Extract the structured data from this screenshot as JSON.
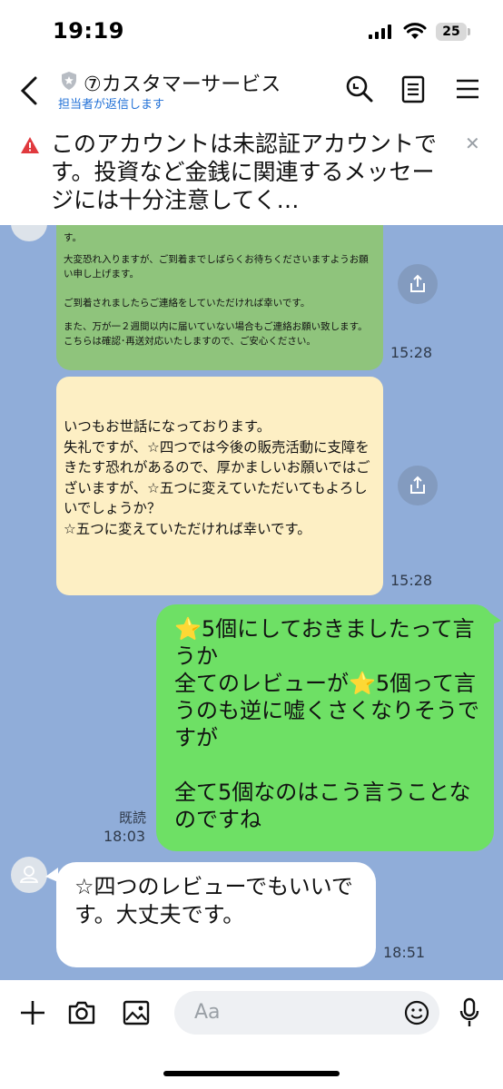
{
  "status_bar": {
    "time": "19:19",
    "battery": "25"
  },
  "header": {
    "account_name": "⑦カスタマーサービス",
    "subtitle": "担当者が返信します"
  },
  "warning": {
    "text": "このアカウントは未認証アカウントです。投資など金銭に関連するメッセージには十分注意してく…",
    "close_glyph": "✕"
  },
  "messages": [
    {
      "from": "other",
      "style": "green-image",
      "lines": [
        "す。",
        "大変恐れ入りますが、ご到着までしばらくお待ちくださいますようお願い申し上げます。",
        "ご到着されましたらご連絡をしていただければ幸いです。",
        "また、万が一２週間以内に届いていない場合もご連絡お願い致します。こちらは確認･再送対応いたしますので、ご安心ください。"
      ],
      "time": "15:28"
    },
    {
      "from": "other",
      "style": "yellow-image",
      "text": "いつもお世話になっております。\n失礼ですが、☆四つでは今後の販売活動に支障をきたす恐れがあるので、厚かましいお願いではございますが、☆五つに変えていただいてもよろしいでしょうか？\n☆五つに変えていただければ幸いです。",
      "time": "15:28"
    },
    {
      "from": "me",
      "text": "⭐5個にしておきましたって言うか\n全てのレビューが⭐5個って言うのも逆に嘘くさくなりそうですが\n\n全て5個なのはこう言うことなのですね",
      "read_label": "既読",
      "time": "18:03"
    },
    {
      "from": "other",
      "text": "☆四つのレビューでもいいです。大丈夫です。",
      "time": "18:51"
    }
  ],
  "input": {
    "placeholder": "Aa"
  },
  "colors": {
    "chat_bg": "#90add9",
    "my_bubble": "#6ee065",
    "warning_red": "#e0393e",
    "link_blue": "#1f6fd6"
  },
  "icons": [
    "back-icon",
    "shield-icon",
    "search-icon",
    "note-icon",
    "menu-icon",
    "warning-icon",
    "close-icon",
    "share-icon",
    "avatar-icon",
    "plus-icon",
    "camera-icon",
    "image-icon",
    "emoji-icon",
    "mic-icon"
  ]
}
